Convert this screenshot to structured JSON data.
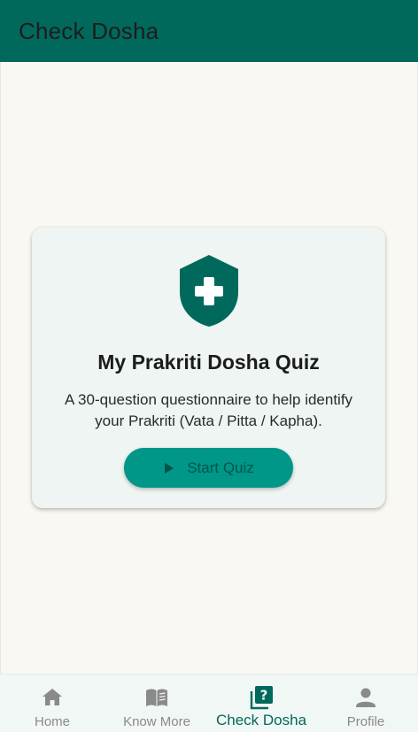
{
  "app_bar": {
    "title": "Check Dosha"
  },
  "card": {
    "icon": "shield-plus-icon",
    "title": "My Prakriti Dosha Quiz",
    "description": "A 30-question questionnaire to help identify your Prakriti (Vata / Pitta / Kapha).",
    "button_label": "Start Quiz",
    "button_icon": "play-icon"
  },
  "bottom_nav": {
    "items": [
      {
        "label": "Home",
        "icon": "home-icon",
        "active": false
      },
      {
        "label": "Know More",
        "icon": "book-icon",
        "active": false
      },
      {
        "label": "Check Dosha",
        "icon": "quiz-icon",
        "active": true
      },
      {
        "label": "Profile",
        "icon": "person-icon",
        "active": false
      }
    ]
  },
  "colors": {
    "primary": "#00695c",
    "accent": "#009688",
    "background": "#faf8f3",
    "card": "#eef5f2",
    "nav_inactive": "#8a8a8a"
  }
}
